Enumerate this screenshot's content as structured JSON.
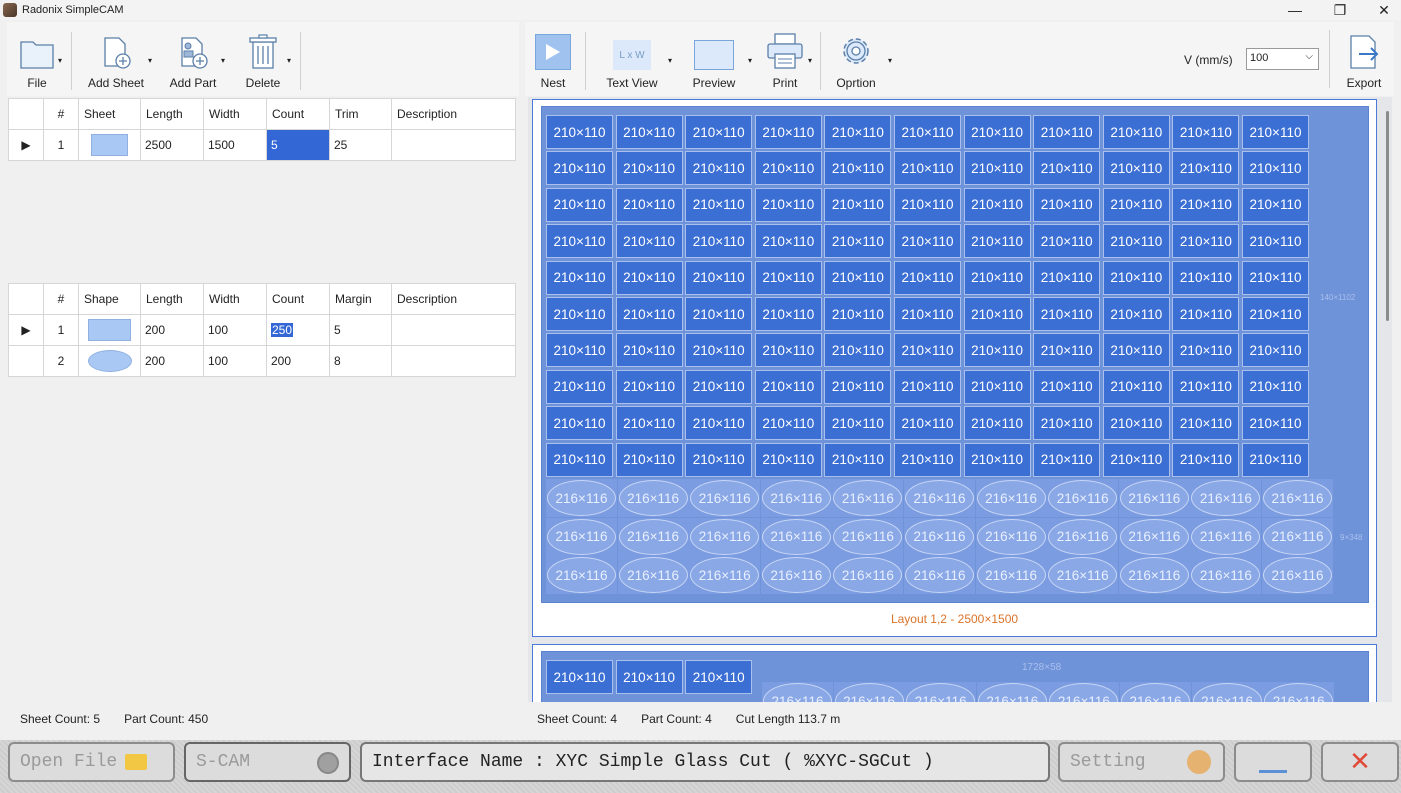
{
  "window": {
    "title": "Radonix SimpleCAM",
    "minimize": "—",
    "restore": "❐",
    "close": "✕"
  },
  "left_toolbar": {
    "file": "File",
    "add_sheet": "Add Sheet",
    "add_part": "Add Part",
    "delete": "Delete"
  },
  "sheets_table": {
    "headers": [
      "#",
      "Sheet",
      "Length",
      "Width",
      "Count",
      "Trim",
      "Description"
    ],
    "rows": [
      {
        "num": "1",
        "length": "2500",
        "width": "1500",
        "count": "5",
        "trim": "25",
        "description": ""
      }
    ]
  },
  "parts_table": {
    "headers": [
      "#",
      "Shape",
      "Length",
      "Width",
      "Count",
      "Margin",
      "Description"
    ],
    "rows": [
      {
        "num": "1",
        "shape": "rectangle",
        "length": "200",
        "width": "100",
        "count": "250",
        "margin": "5",
        "description": ""
      },
      {
        "num": "2",
        "shape": "ellipse",
        "length": "200",
        "width": "100",
        "count": "200",
        "margin": "8",
        "description": ""
      }
    ]
  },
  "left_status": {
    "sheet_count": "Sheet Count: 5",
    "part_count": "Part Count: 450"
  },
  "right_toolbar": {
    "nest": "Nest",
    "text_view": "Text View",
    "text_view_icon": "L x W",
    "preview": "Preview",
    "print": "Print",
    "option": "Oprtion",
    "speed_label": "V (mm/s)",
    "speed_value": "100",
    "export": "Export"
  },
  "layouts": {
    "rect_label": "210×110",
    "ellipse_label": "216×116",
    "remnant_right": "140×1102",
    "remnant_ellipse": "9×348",
    "remnant_top": "1728×58",
    "caption_1": "Layout 1,2 - 2500×1500"
  },
  "right_status": {
    "sheet_count": "Sheet Count: 4",
    "part_count": "Part Count: 4",
    "cut_length": "Cut Length 113.7 m"
  },
  "appbar": {
    "open_file": "Open File",
    "scam": "S-CAM",
    "interface_name": "Interface Name : XYC Simple Glass Cut ( %XYC-SGCut )",
    "setting": "Setting"
  },
  "colors": {
    "accent": "#3367d6",
    "rect_part": "#3c6fd4",
    "sheet": "#6f93d8",
    "caption": "#d9732a",
    "close_red": "#e04a3a"
  }
}
